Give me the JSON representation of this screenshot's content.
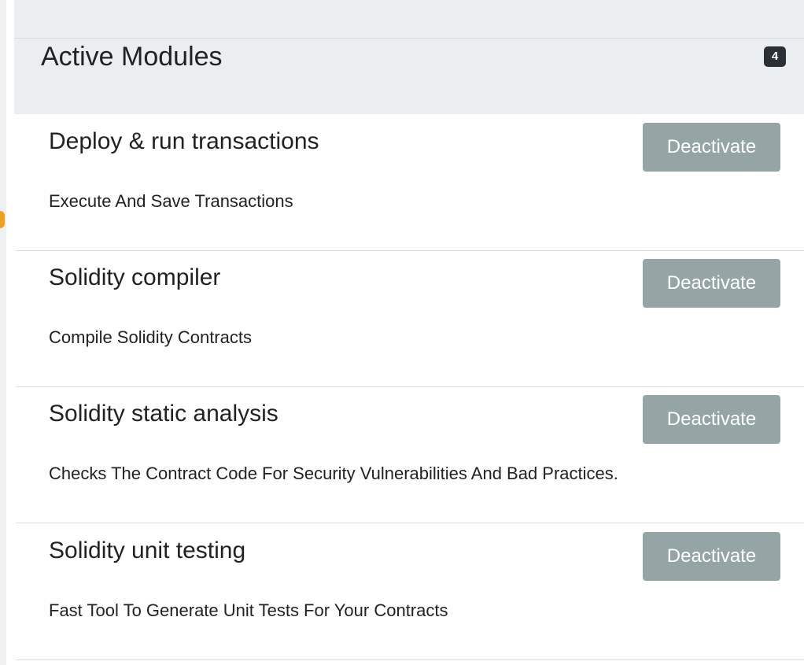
{
  "section": {
    "title": "Active Modules",
    "count": "4"
  },
  "modules": [
    {
      "name": "Deploy & run transactions",
      "description": "Execute And Save Transactions",
      "action_label": "Deactivate"
    },
    {
      "name": "Solidity compiler",
      "description": "Compile Solidity Contracts",
      "action_label": "Deactivate"
    },
    {
      "name": "Solidity static analysis",
      "description": "Checks The Contract Code For Security Vulnerabilities And Bad Practices.",
      "action_label": "Deactivate"
    },
    {
      "name": "Solidity unit testing",
      "description": "Fast Tool To Generate Unit Tests For Your Contracts",
      "action_label": "Deactivate"
    }
  ],
  "colors": {
    "header_bg": "#ebeef1",
    "badge_bg": "#2b2f36",
    "button_bg": "#95a5a6",
    "accent": "#f0a020"
  }
}
